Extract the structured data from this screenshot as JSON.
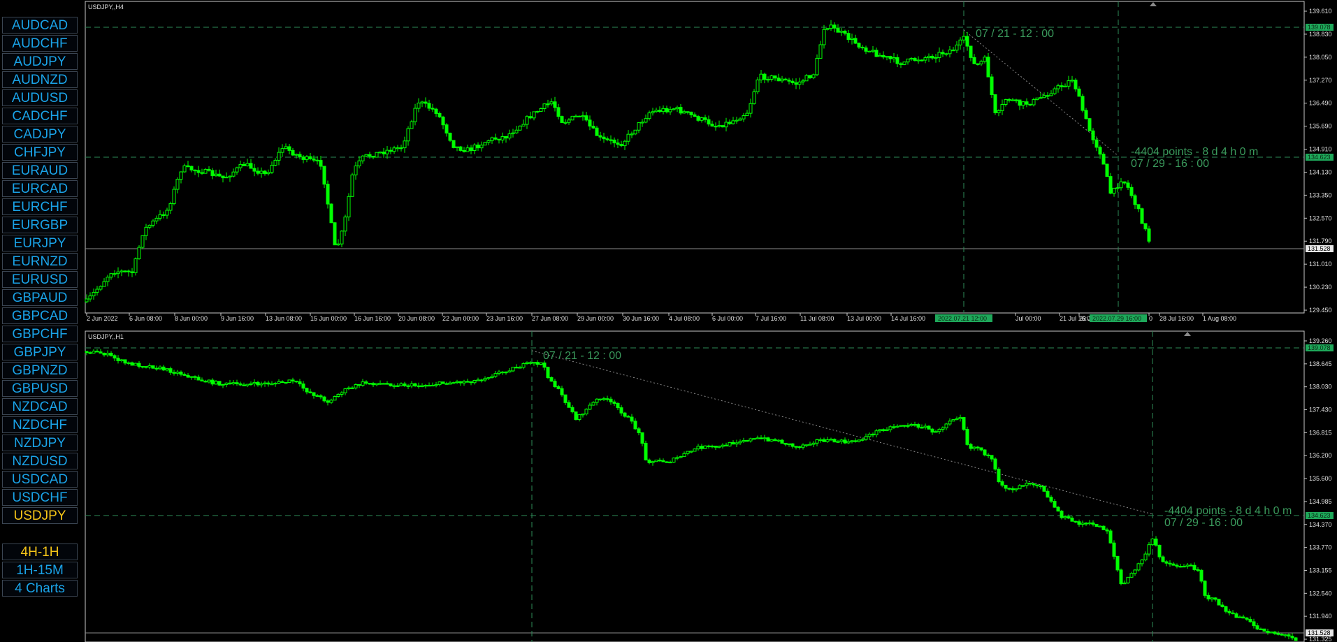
{
  "sidebar": {
    "symbols": [
      "AUDCAD",
      "AUDCHF",
      "AUDJPY",
      "AUDNZD",
      "AUDUSD",
      "CADCHF",
      "CADJPY",
      "CHFJPY",
      "EURAUD",
      "EURCAD",
      "EURCHF",
      "EURGBP",
      "EURJPY",
      "EURNZD",
      "EURUSD",
      "GBPAUD",
      "GBPCAD",
      "GBPCHF",
      "GBPJPY",
      "GBPNZD",
      "GBPUSD",
      "NZDCAD",
      "NZDCHF",
      "NZDJPY",
      "NZDUSD",
      "USDCAD",
      "USDCHF",
      "USDJPY"
    ],
    "active_symbol": "USDJPY",
    "modes": [
      "4H-1H",
      "1H-15M",
      "4 Charts"
    ],
    "active_mode": "4H-1H"
  },
  "colors": {
    "background": "#000000",
    "candle": "#00ff00",
    "crosshair": "#2e8b57",
    "annotation": "#3a9a5c",
    "button_text": "#1aa3e8",
    "button_active": "#f5c518"
  },
  "charts": [
    {
      "title": "USDJPY,,H4",
      "y_ticks": [
        "139.610",
        "138.830",
        "138.050",
        "137.270",
        "136.490",
        "135.690",
        "134.910",
        "134.130",
        "133.350",
        "132.570",
        "131.790",
        "131.010",
        "130.230",
        "129.450"
      ],
      "x_ticks": [
        "2 Jun 2022",
        "6 Jun 08:00",
        "8 Jun 00:00",
        "9 Jun 16:00",
        "13 Jun 08:00",
        "15 Jun 00:00",
        "16 Jun 16:00",
        "20 Jun 08:00",
        "22 Jun 00:00",
        "23 Jun 16:00",
        "27 Jun 08:00",
        "29 Jun 00:00",
        "30 Jun 16:00",
        "4 Jul 08:00",
        "6 Jul 00:00",
        "7 Jul 16:00",
        "11 Jul 08:00",
        "13 Jul 00:00",
        "14 Jul 16:00",
        "Jul 00:00",
        "21 Jul 16:00",
        "25 Jul",
        "0",
        "28 Jul 16:00",
        "1 Aug 08:00"
      ],
      "x_highlights": [
        "2022.07.21 12:00",
        "2022.07.29 16:00"
      ],
      "price_tags": {
        "top": "139.078",
        "mid": "134.623",
        "bid": "131.528"
      },
      "annotation_start": "07 / 21 - 12 : 00",
      "annotation_measure": "-4404 points - 8 d 4 h 0 m",
      "annotation_end": "07 / 29 - 16 : 00"
    },
    {
      "title": "USDJPY,,H1",
      "y_ticks": [
        "139.260",
        "138.645",
        "138.030",
        "137.430",
        "136.815",
        "136.200",
        "135.600",
        "134.985",
        "134.370",
        "133.770",
        "133.155",
        "132.540",
        "131.940",
        "131.325"
      ],
      "price_tags": {
        "top": "139.078",
        "mid": "134.623",
        "bid": "131.528"
      },
      "annotation_start": "07 / 21 - 12 : 00",
      "annotation_measure": "-4404 points - 8 d 4 h 0 m",
      "annotation_end": "07 / 29 - 16 : 00"
    }
  ]
}
